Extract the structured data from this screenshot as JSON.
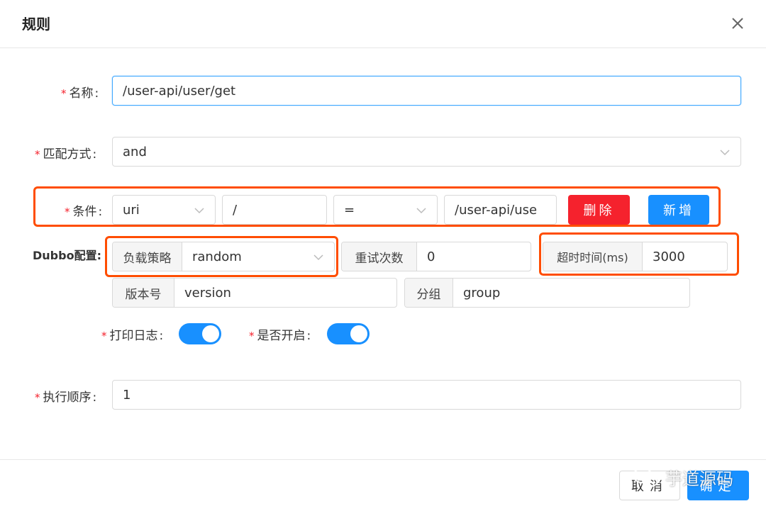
{
  "dialog": {
    "title": "规则",
    "close_icon": "close-icon"
  },
  "form": {
    "name": {
      "label": "名称",
      "value": "/user-api/user/get"
    },
    "match_mode": {
      "label": "匹配方式",
      "value": "and"
    },
    "condition": {
      "label": "条件",
      "param_type": "uri",
      "param_name": "/",
      "operator": "=",
      "param_value": "/user-api/use",
      "delete_label": "删除",
      "add_label": "新增"
    },
    "dubbo": {
      "label": "Dubbo配置:",
      "load_balance": {
        "label": "负载策略",
        "value": "random"
      },
      "retries": {
        "label": "重试次数",
        "value": "0"
      },
      "timeout": {
        "label": "超时时间(ms)",
        "value": "3000"
      },
      "version": {
        "label": "版本号",
        "placeholder": "version"
      },
      "group": {
        "label": "分组",
        "placeholder": "group"
      }
    },
    "logged": {
      "label": "打印日志",
      "on": true
    },
    "enabled": {
      "label": "是否开启",
      "on": true
    },
    "sort": {
      "label": "执行顺序",
      "value": "1"
    }
  },
  "footer": {
    "cancel_label": "取消",
    "ok_label": "确定"
  },
  "watermark": {
    "text": "芋道源码"
  },
  "colors": {
    "primary": "#1890ff",
    "danger": "#f5222d",
    "highlight": "#ff4d00",
    "required": "#f5222d"
  }
}
